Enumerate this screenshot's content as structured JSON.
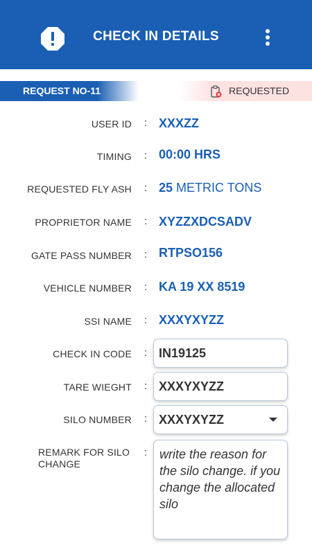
{
  "header": {
    "title": "CHECK IN DETAILS",
    "alert_icon": "alert-octagon-icon",
    "menu_icon": "more-vertical-icon",
    "color": "#1a5fb4"
  },
  "request": {
    "number_label": "REQUEST NO-11",
    "status_label": "REQUESTED",
    "status_icon": "clipboard-cancel-icon",
    "status_bg": "#fde2e2"
  },
  "details": {
    "user_id_label": "USER ID",
    "user_id_value": "XXXZZ",
    "timing_label": "TIMING",
    "timing_value": "00:00 HRS",
    "fly_ash_label": "REQUESTED FLY ASH",
    "fly_ash_amount": "25",
    "fly_ash_unit": "METRIC TONS",
    "proprietor_label": "PROPRIETOR NAME",
    "proprietor_value": "XYZZXDCSADV",
    "gate_pass_label": "GATE PASS NUMBER",
    "gate_pass_value": "RTPSO156",
    "vehicle_label": "VEHICLE NUMBER",
    "vehicle_value": "KA 19 XX 8519",
    "ssi_label": "SSI NAME",
    "ssi_value": "XXXYXYZZ"
  },
  "form": {
    "check_in_label": "CHECK IN CODE",
    "check_in_value": "IN19125",
    "tare_label": "TARE WIEGHT",
    "tare_value": "XXXYXYZZ",
    "silo_label": "SILO NUMBER",
    "silo_value": "XXXYXYZZ",
    "remark_label": "REMARK FOR SILO CHANGE",
    "remark_label_line1": "REMARK FOR SILO",
    "remark_label_line2": "CHANGE",
    "remark_value": "write the reason for the silo change. if you change the allocated silo"
  },
  "colon": ":"
}
